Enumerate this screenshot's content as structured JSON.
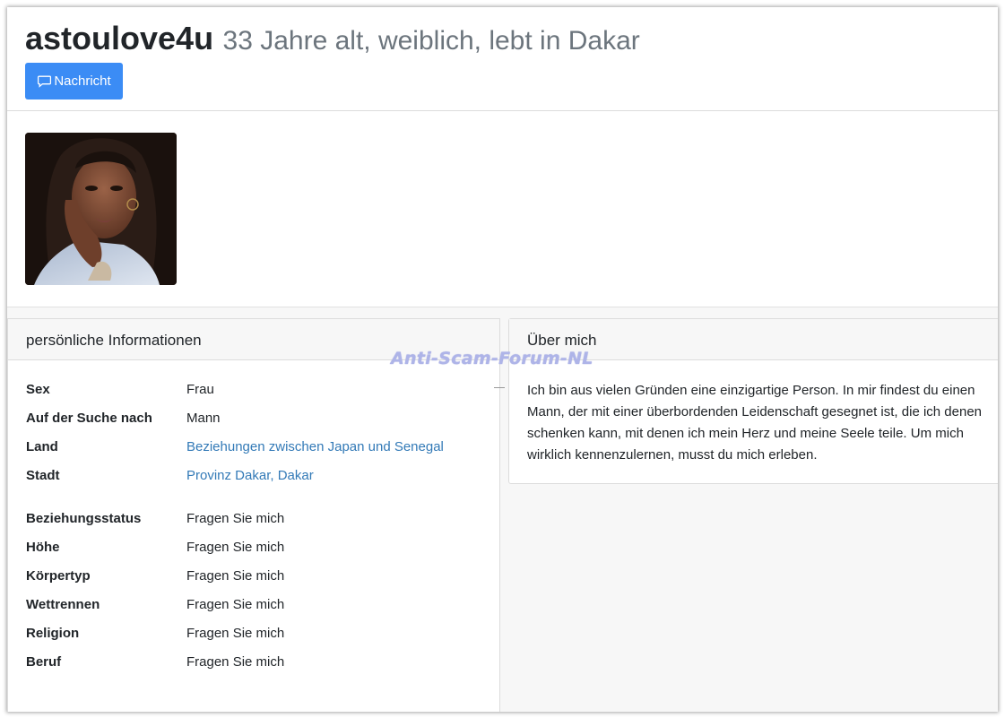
{
  "profile": {
    "username": "astoulove4u",
    "subtitle": "33 Jahre alt, weiblich, lebt in Dakar",
    "message_button": "Nachricht"
  },
  "personal_info": {
    "title": "persönliche Informationen",
    "rows_top": [
      {
        "label": "Sex",
        "value": "Frau",
        "link": false
      },
      {
        "label": "Auf der Suche nach",
        "value": "Mann",
        "link": false
      },
      {
        "label": "Land",
        "value": "Beziehungen zwischen Japan und Senegal",
        "link": true
      },
      {
        "label": "Stadt",
        "value_parts": [
          "Provinz Dakar",
          ", ",
          "Dakar"
        ],
        "link": true
      }
    ],
    "rows_bottom": [
      {
        "label": "Beziehungsstatus",
        "value": "Fragen Sie mich"
      },
      {
        "label": "Höhe",
        "value": "Fragen Sie mich"
      },
      {
        "label": "Körpertyp",
        "value": "Fragen Sie mich"
      },
      {
        "label": "Wettrennen",
        "value": "Fragen Sie mich"
      },
      {
        "label": "Religion",
        "value": "Fragen Sie mich"
      },
      {
        "label": "Beruf",
        "value": "Fragen Sie mich"
      }
    ]
  },
  "about": {
    "title": "Über mich",
    "text": "Ich bin aus vielen Gründen eine einzigartige Person. In mir findest du einen Mann, der mit einer überbordenden Leidenschaft gesegnet ist, die ich denen schenken kann, mit denen ich mein Herz und meine Seele teile. Um mich wirklich kennenzulernen, musst du mich erleben."
  },
  "watermark": "Anti-Scam-Forum-NL",
  "colors": {
    "accent": "#3b8cf5",
    "link": "#337ab7",
    "muted": "#6c757d"
  },
  "icons": {
    "message_button": "chat-bubble-icon"
  }
}
